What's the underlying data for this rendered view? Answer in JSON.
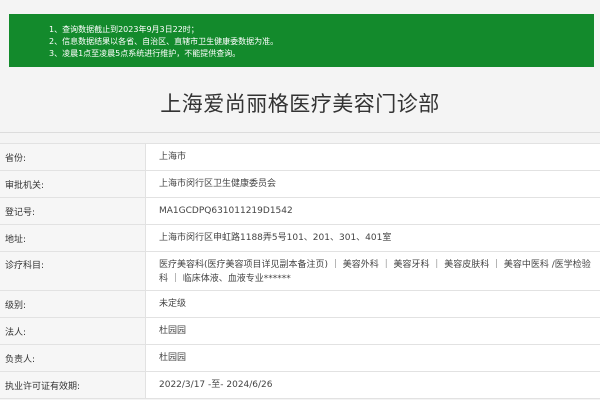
{
  "notice": {
    "lines": [
      "1、查询数据截止到2023年9月3日22时；",
      "2、信息数据结果以各省、自治区、直辖市卫生健康委数据为准。",
      "3、凌晨1点至凌晨5点系统进行维护，不能提供查询。"
    ]
  },
  "page_title": "上海爱尚丽格医疗美容门诊部",
  "details": [
    {
      "label": "省份:",
      "value": "上海市"
    },
    {
      "label": "审批机关:",
      "value": "上海市闵行区卫生健康委员会"
    },
    {
      "label": "登记号:",
      "value": "MA1GCDPQ631011219D1542"
    },
    {
      "label": "地址:",
      "value": "上海市闵行区申虹路1188弄5号101、201、301、401室"
    },
    {
      "label": "诊疗科目:",
      "value": "医疗美容科(医疗美容项目详见副本备注页) ｜ 美容外科 ｜ 美容牙科 ｜ 美容皮肤科 ｜ 美容中医科 /医学检验科 ｜ 临床体液、血液专业******"
    },
    {
      "label": "级别:",
      "value": "未定级"
    },
    {
      "label": "法人:",
      "value": "杜园园"
    },
    {
      "label": "负责人:",
      "value": "杜园园"
    },
    {
      "label": "执业许可证有效期:",
      "value": "2022/3/17 -至- 2024/6/26"
    }
  ],
  "colors": {
    "notice_bg": "#138a2c",
    "notice_text": "#ffffff"
  }
}
